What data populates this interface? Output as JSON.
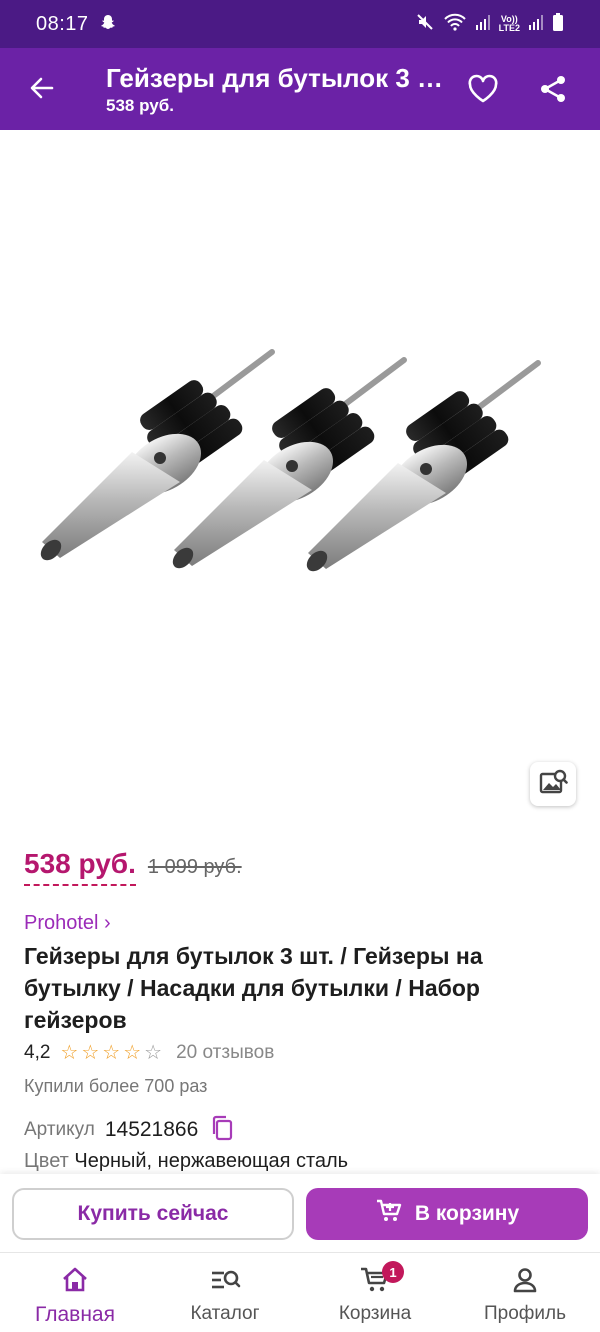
{
  "status_bar": {
    "time": "08:17",
    "lte_top": "Vo))",
    "lte_bottom": "LTE2"
  },
  "app_bar": {
    "title": "Гейзеры для бутылок 3 шт. / Гейзеры на бутылку",
    "subtitle": "538 руб."
  },
  "product": {
    "price_current": "538 руб.",
    "price_old": "1 099 руб.",
    "brand": "Prohotel ›",
    "title": "Гейзеры для бутылок 3 шт. / Гейзеры на бутылку / Насадки для бутылки / Набор гейзеров",
    "rating": "4,2",
    "stars_filled": 4,
    "stars_total": 5,
    "reviews": "20 отзывов",
    "bought": "Купили более 700 раз",
    "sku_label": "Артикул",
    "sku_value": "14521866",
    "color_label": "Цвет",
    "color_value": "Черный, нержавеющая сталь"
  },
  "actions": {
    "buy_now": "Купить сейчас",
    "add_to_cart": "В корзину"
  },
  "bottom_nav": {
    "home": "Главная",
    "catalog": "Каталог",
    "cart": "Корзина",
    "cart_count": "1",
    "profile": "Профиль"
  },
  "colors": {
    "status_bar": "#4b1a85",
    "app_bar": "#6b22a6",
    "accent_price": "#b5176e",
    "brand": "#9b2bb8",
    "cart_button": "#a73bb8",
    "star": "#f0a02a"
  },
  "icons": {
    "back": "arrow-left-icon",
    "favorite": "heart-icon",
    "share": "share-icon",
    "photo_search": "image-search-icon",
    "copy": "copy-icon",
    "cart_add": "cart-plus-icon",
    "home": "home-icon",
    "catalog": "catalog-search-icon",
    "cart": "cart-icon",
    "profile": "person-icon"
  }
}
